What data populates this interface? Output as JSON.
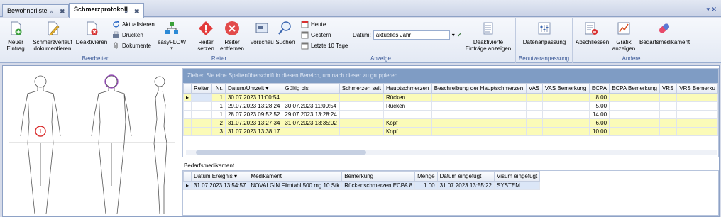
{
  "tabs": [
    {
      "label": "Bewohnerliste",
      "active": false
    },
    {
      "label": "Schmerzprotokoll",
      "active": true
    }
  ],
  "tab_glyphs": {
    "pin": "»",
    "close": "✖",
    "menu": "▾ ✕"
  },
  "ribbon": {
    "bearbeiten": {
      "label": "Bearbeiten",
      "neuer_eintrag": "Neuer Eintrag",
      "schmerzverlauf": "Schmerzverlauf dokumentieren",
      "deaktivieren": "Deaktivieren",
      "aktualisieren": "Aktualisieren",
      "drucken": "Drucken",
      "dokumente": "Dokumente",
      "easyflow": "easyFLOW"
    },
    "reiter": {
      "label": "Reiter",
      "setzen": "Reiter setzen",
      "entfernen": "Reiter entfernen"
    },
    "anzeige": {
      "label": "Anzeige",
      "vorschau": "Vorschau",
      "suchen": "Suchen",
      "heute": "Heute",
      "gestern": "Gestern",
      "letzte": "Letzte 10 Tage",
      "datum_label": "Datum:",
      "datum_value": "aktuelles Jahr",
      "deaktivierte": "Deaktivierte Einträge anzeigen"
    },
    "benutzer": {
      "label": "Benutzeranpassung",
      "datenanpassung": "Datenanpassung"
    },
    "andere": {
      "label": "Andere",
      "abschliessen": "Abschliessen",
      "grafik": "Grafik anzeigen",
      "bedarf": "Bedarfsmedikament"
    }
  },
  "body_marker": "1",
  "grid": {
    "group_hint": "Ziehen Sie eine Spaltenüberschrift in diesen Bereich, um nach dieser zu gruppieren",
    "columns": [
      "Reiter",
      "Nr.",
      "Datum/Uhrzeit",
      "Gültig bis",
      "Schmerzen seit",
      "Hauptschmerzen",
      "Beschreibung der Hauptschmerzen",
      "VAS",
      "VAS Bemerkung",
      "ECPA",
      "ECPA Bemerkung",
      "VRS",
      "VRS Bemerku"
    ],
    "sort_glyph": "▾",
    "row_pointer": "▸",
    "rows": [
      [
        "",
        "1",
        "30.07.2023 11:00:54",
        "",
        "",
        "Rücken",
        "",
        "",
        "",
        "8.00",
        "",
        "",
        ""
      ],
      [
        "",
        "1",
        "29.07.2023 13:28:24",
        "30.07.2023 11:00:54",
        "",
        "Rücken",
        "",
        "",
        "",
        "5.00",
        "",
        "",
        ""
      ],
      [
        "",
        "1",
        "28.07.2023 09:52:52",
        "29.07.2023 13:28:24",
        "",
        "",
        "",
        "",
        "",
        "14.00",
        "",
        "",
        ""
      ],
      [
        "",
        "2",
        "31.07.2023 13:27:34",
        "31.07.2023 13:35:02",
        "",
        "Kopf",
        "",
        "",
        "",
        "6.00",
        "",
        "",
        ""
      ],
      [
        "",
        "3",
        "31.07.2023 13:38:17",
        "",
        "",
        "Kopf",
        "",
        "",
        "",
        "10.00",
        "",
        "",
        ""
      ]
    ]
  },
  "bedarf": {
    "title": "Bedarfsmedikament",
    "columns": [
      "Datum Ereignis",
      "Medikament",
      "Bemerkung",
      "Menge",
      "Datum eingefügt",
      "Visum eingefügt"
    ],
    "rows": [
      [
        "31.07.2023 13:54:57",
        "NOVALGIN Filmtabl 500 mg 10 Stk",
        "Rückenschmerzen ECPA 8",
        "1.00",
        "31.07.2023 13:55:22",
        "SYSTEM"
      ]
    ]
  },
  "colors": {
    "highlight": "#fbfbb8",
    "marker": "#d92b2b",
    "accent": "#3b5998"
  }
}
